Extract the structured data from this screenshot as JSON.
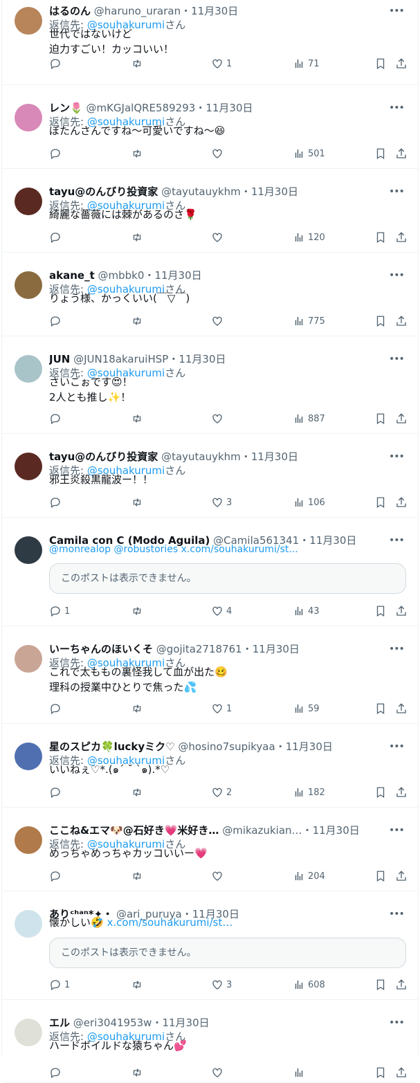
{
  "reply_prefix": "返信先: ",
  "reply_suffix": "さん",
  "posts": [
    {
      "name": "はるのん",
      "handle": "@haruno_uraran",
      "dot": "・",
      "date": "11月30日",
      "reply_to": "@souhakurumi",
      "text": [
        "世代ではないけど",
        "迫力すごい！カッコいい！"
      ],
      "replies": "",
      "retweets": "",
      "likes": "1",
      "views": "71",
      "avatar_color": "#b8845a"
    },
    {
      "name": "レン🌷",
      "handle": "@mKGJalQRE589293",
      "dot": "・",
      "date": "11月30日",
      "reply_to": "@souhakurumi",
      "text": [
        "ぼたんさんですね～可愛いですね～😆"
      ],
      "replies": "",
      "retweets": "",
      "likes": "",
      "views": "501",
      "avatar_color": "#d889b8"
    },
    {
      "name": "tayu@のんびり投資家",
      "handle": "@tayutauykhm",
      "dot": "・",
      "date": "11月30日",
      "reply_to": "@souhakurumi",
      "text": [
        "綺麗な薔薇には棘があるのさ🌹"
      ],
      "replies": "",
      "retweets": "",
      "likes": "",
      "views": "120",
      "avatar_color": "#5a2a22"
    },
    {
      "name": "akane_t",
      "handle": "@mbbk0",
      "dot": "・",
      "date": "11月30日",
      "reply_to": "@souhakurumi",
      "text": [
        "りょう様、かっくいい(￣▽￣)"
      ],
      "replies": "",
      "retweets": "",
      "likes": "",
      "views": "775",
      "avatar_color": "#8a6b3f"
    },
    {
      "name": "JUN",
      "handle": "@JUN18akaruiHSP",
      "dot": "・",
      "date": "11月30日",
      "reply_to": "@souhakurumi",
      "text": [
        "さいこぉです😍！",
        "2人とも推し✨！"
      ],
      "replies": "",
      "retweets": "",
      "likes": "",
      "views": "887",
      "avatar_color": "#a9c4c8"
    },
    {
      "name": "tayu@のんびり投資家",
      "handle": "@tayutauykhm",
      "dot": "・",
      "date": "11月30日",
      "reply_to": "@souhakurumi",
      "text": [
        "邪王炎殺黒龍波ー！！"
      ],
      "replies": "",
      "retweets": "",
      "likes": "3",
      "views": "106",
      "avatar_color": "#5a2a22"
    },
    {
      "name": "Camila con C (Modo Aguila)",
      "handle": "@Camila561341",
      "dot": "・",
      "date": "11月30日",
      "link_line": "@monrealop @robustories x.com/souhakurumi/st...",
      "quote": "このポストは表示できません。",
      "replies": "1",
      "retweets": "",
      "likes": "4",
      "views": "43",
      "avatar_color": "#2e3a44"
    },
    {
      "name": "いーちゃんのほいくそ",
      "handle": "@gojita2718761",
      "dot": "・",
      "date": "11月30日",
      "reply_to": "@souhakurumi",
      "text": [
        "これで太ももの裏怪我して血が出た🥴",
        "理科の授業中ひとりで焦った💦"
      ],
      "replies": "",
      "retweets": "",
      "likes": "1",
      "views": "59",
      "avatar_color": "#c9a595"
    },
    {
      "name": "星のスピカ🍀luckyミク♡",
      "handle": "@hosino7supikyaa",
      "dot": "・",
      "date": "11月30日",
      "reply_to": "@souhakurumi",
      "text": [
        "いいねぇ♡*.(๑´ ˘ `๑).*♡"
      ],
      "replies": "",
      "retweets": "",
      "likes": "2",
      "views": "182",
      "avatar_color": "#4f6fb0"
    },
    {
      "name": "ここね&エマ🐶@石好き💗米好き…",
      "handle": "@mikazukian…",
      "dot": "・",
      "date": "11月30日",
      "reply_to": "@souhakurumi",
      "text": [
        "めっちゃめっちゃカッコいいー💗"
      ],
      "replies": "",
      "retweets": "",
      "likes": "",
      "views": "204",
      "avatar_color": "#b07a4a"
    },
    {
      "name": "ありᶜʰᵃⁿ*✦・",
      "handle": "@ari_puruya",
      "dot": "・",
      "date": "11月30日",
      "text_link": "x.com/souhakurumi/st…",
      "text_prefix": "懐かしい🤣 ",
      "quote": "このポストは表示できません。",
      "replies": "1",
      "retweets": "",
      "likes": "3",
      "views": "608",
      "avatar_color": "#cfe3ec"
    },
    {
      "name": "エル",
      "handle": "@eri3041953w",
      "dot": "・",
      "date": "11月30日",
      "reply_to": "@souhakurumi",
      "text": [
        "ハードボイルドな猿ちゃん💕"
      ],
      "replies": "",
      "retweets": "",
      "likes": "",
      "views": "",
      "avatar_color": "#dfe0d8"
    }
  ]
}
